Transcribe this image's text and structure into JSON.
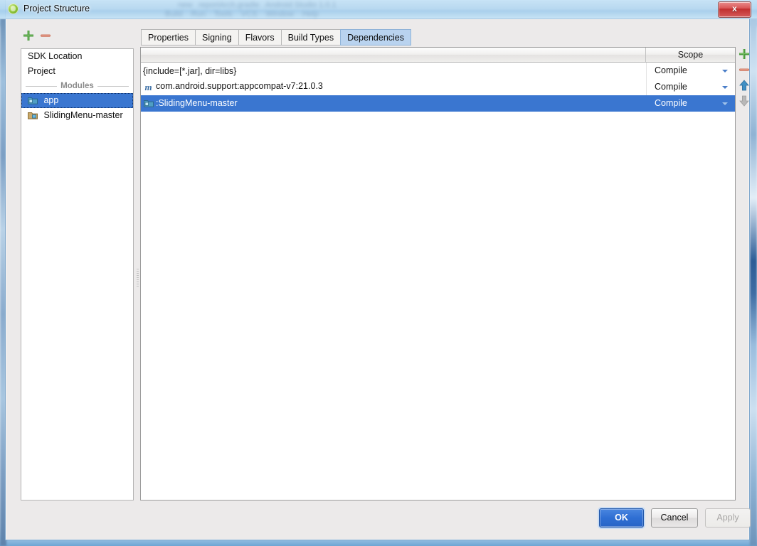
{
  "window": {
    "title": "Project Structure",
    "app_icon": "android-studio-icon",
    "close_label": "x"
  },
  "side_toolbar": {
    "add_label": "+",
    "remove_label": "−",
    "add_icon": "plus-icon",
    "remove_icon": "minus-icon"
  },
  "sidebar": {
    "items": [
      {
        "label": "SDK Location",
        "type": "item",
        "selected": false,
        "icon": ""
      },
      {
        "label": "Project",
        "type": "item",
        "selected": false,
        "icon": ""
      },
      {
        "label": "Modules",
        "type": "separator",
        "selected": false,
        "icon": ""
      },
      {
        "label": "app",
        "type": "module",
        "selected": true,
        "icon": "module-icon"
      },
      {
        "label": "SlidingMenu-master",
        "type": "module",
        "selected": false,
        "icon": "module-icon"
      }
    ]
  },
  "tabs": [
    {
      "label": "Properties",
      "active": false
    },
    {
      "label": "Signing",
      "active": false
    },
    {
      "label": "Flavors",
      "active": false
    },
    {
      "label": "Build Types",
      "active": false
    },
    {
      "label": "Dependencies",
      "active": true
    }
  ],
  "table": {
    "columns": {
      "name": "",
      "scope": "Scope"
    },
    "rows": [
      {
        "icon": "",
        "name": "{include=[*.jar], dir=libs}",
        "scope": "Compile",
        "selected": false,
        "has_dropdown": true
      },
      {
        "icon": "maven-icon",
        "icon_glyph": "m",
        "name": "com.android.support:appcompat-v7:21.0.3",
        "scope": "Compile",
        "selected": false,
        "has_dropdown": true
      },
      {
        "icon": "module-icon",
        "name": ":SlidingMenu-master",
        "scope": "Compile",
        "selected": true,
        "has_dropdown": true
      }
    ]
  },
  "dep_toolbar": {
    "add_icon": "plus-icon",
    "remove_icon": "minus-icon",
    "move_up_icon": "arrow-up-icon",
    "move_down_icon": "arrow-down-icon"
  },
  "footer": {
    "ok_label": "OK",
    "cancel_label": "Cancel",
    "apply_label": "Apply"
  },
  "colors": {
    "selection_blue": "#3a76d0",
    "active_tab_blue": "#b9d3ef",
    "ok_button_blue": "#2f6fd3",
    "plus_green": "#4a9b3f",
    "minus_red": "#d0765e",
    "arrow_blue": "#3f8fc4"
  }
}
